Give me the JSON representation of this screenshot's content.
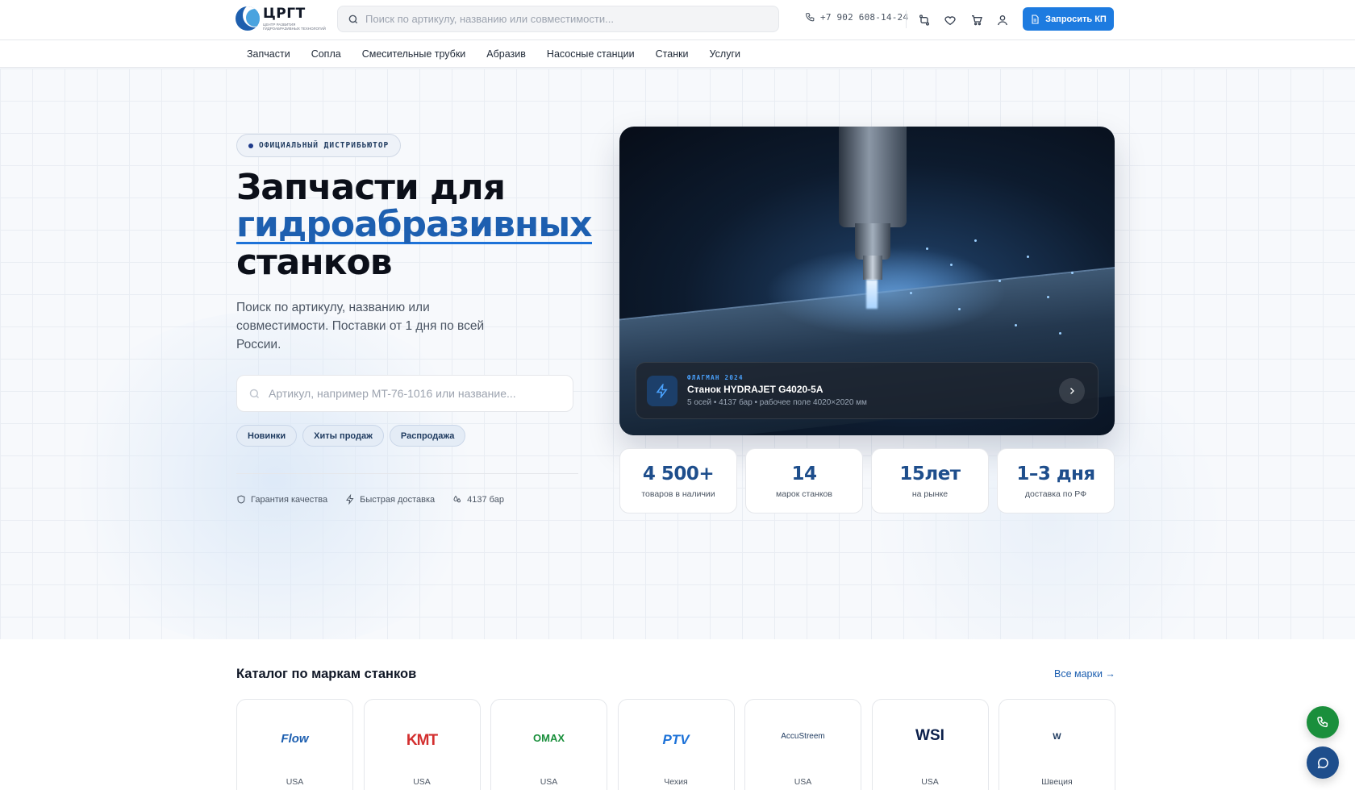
{
  "header": {
    "logo": {
      "name": "ЦРГТ",
      "sub_line1": "ЦЕНТР РАЗВИТИЯ",
      "sub_line2": "ГИДРОАБРАЗИВНЫХ ТЕХНОЛОГИЙ"
    },
    "search": {
      "placeholder": "Поиск по артикулу, названию или совместимости..."
    },
    "phone": "+7 902 608-14-24",
    "icons": [
      "compare-icon",
      "heart-icon",
      "cart-icon",
      "user-icon"
    ],
    "cta_label": "Запросить КП",
    "accent_color": "#1d7be0"
  },
  "nav": [
    "Запчасти",
    "Сопла",
    "Смесительные трубки",
    "Абразив",
    "Насосные станции",
    "Станки",
    "Услуги"
  ],
  "hero": {
    "badge": "ОФИЦИАЛЬНЫЙ ДИСТРИБЬЮТОР",
    "title_line1": "Запчасти для",
    "title_accent": "гидроабразивных",
    "title_line3": "станков",
    "lead": "Поиск по артикулу, названию или совместимости. Поставки от 1 дня по всей России.",
    "search_placeholder": "Артикул, например MT-76-1016 или название...",
    "chips": [
      "Новинки",
      "Хиты продаж",
      "Распродажа"
    ],
    "features": [
      {
        "icon": "shield-icon",
        "label": "Гарантия качества"
      },
      {
        "icon": "lightning-icon",
        "label": "Быстрая доставка"
      },
      {
        "icon": "drops-icon",
        "label": "4137 бар"
      }
    ],
    "card": {
      "kicker": "ФЛАГМАН 2024",
      "title": "Станок HYDRAJET G4020-5A",
      "subtitle": "5 осей • 4137 бар • рабочее поле 4020×2020 мм"
    },
    "stats": [
      {
        "value": "4 500+",
        "label": "товаров в наличии"
      },
      {
        "value": "14",
        "label": "марок станков"
      },
      {
        "value": "15лет",
        "label": "на рынке"
      },
      {
        "value": "1–3 дня",
        "label": "доставка по РФ"
      }
    ]
  },
  "catalog": {
    "title": "Каталог по маркам станков",
    "all_link": "Все марки →",
    "brands": [
      {
        "name": "Flow",
        "country": "USA",
        "color": "#1d5fb0"
      },
      {
        "name": "KMT",
        "country": "USA",
        "color": "#d32f2f"
      },
      {
        "name": "OMAX",
        "country": "USA",
        "color": "#1a8f3c"
      },
      {
        "name": "PTV",
        "country": "Чехия",
        "color": "#1d72d8"
      },
      {
        "name": "AccuStreem",
        "country": "USA",
        "color": "#1e3a5f"
      },
      {
        "name": "WSI",
        "country": "USA",
        "color": "#0b1f4a"
      },
      {
        "name": "W",
        "country": "Швеция",
        "color": "#1e3a5f"
      }
    ]
  },
  "fabs": {
    "call_color": "#1a8f3c",
    "chat_color": "#1e4e8c"
  }
}
